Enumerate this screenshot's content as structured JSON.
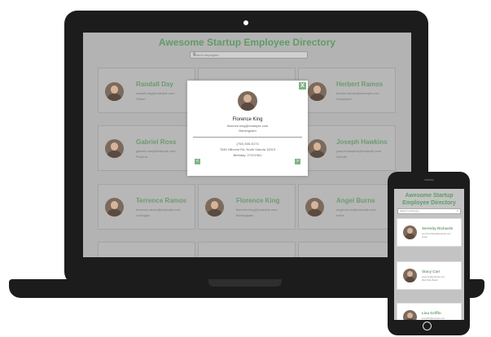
{
  "laptop": {
    "title": "Awesome Startup Employee Directory",
    "search_placeholder": "Search employee...",
    "search_icon": "magnifier-icon",
    "cards": [
      {
        "name": "Randall Day",
        "email": "randall.day@example.com",
        "city": "Gilbert"
      },
      {
        "name": "",
        "email": "",
        "city": ""
      },
      {
        "name": "Herbert Ramos",
        "email": "herbert.ramos@example.com",
        "city": "Hollywood"
      },
      {
        "name": "Gabriel Ross",
        "email": "gabriel.ross@example.com",
        "city": "Phoenix"
      },
      {
        "name": "",
        "email": "",
        "city": ""
      },
      {
        "name": "Joseph Hawkins",
        "email": "joseph.hawkins@example.com",
        "city": "Norfolk"
      },
      {
        "name": "Terrence Ramos",
        "email": "terrence.ramos@example.com",
        "city": "Lexington"
      },
      {
        "name": "Florence King",
        "email": "florence.king@example.com",
        "city": "Birmingham"
      },
      {
        "name": "Angel Burns",
        "email": "angel.burns@example.com",
        "city": "Irvine"
      }
    ]
  },
  "modal": {
    "close_label": "X",
    "name": "Florence King",
    "email": "florence.king@example.com",
    "city": "Birmingham",
    "phone": "(763) 546-5174",
    "address": "7645 Hillcrest Rd, North Dakota 15313",
    "birthday": "Birthday: 27/2/1961",
    "prev_label": "<",
    "next_label": ">"
  },
  "phone": {
    "title": "Awesome Startup Employee Directory",
    "search_placeholder": "Search employee...",
    "cards": [
      {
        "name": "Serenity Richards",
        "email": "serenity.richards@example.com",
        "city": "Austin"
      },
      {
        "name": "Stacy Carr",
        "email": "stacy.carr@example.com",
        "city": "West Palm Beach"
      },
      {
        "name": "Lisa Griffin",
        "email": "lisa.griffin@example.com",
        "city": ""
      }
    ]
  },
  "colors": {
    "accent": "#5f9c66",
    "device": "#1c1c1c",
    "overlay": "#b3b3b3"
  }
}
